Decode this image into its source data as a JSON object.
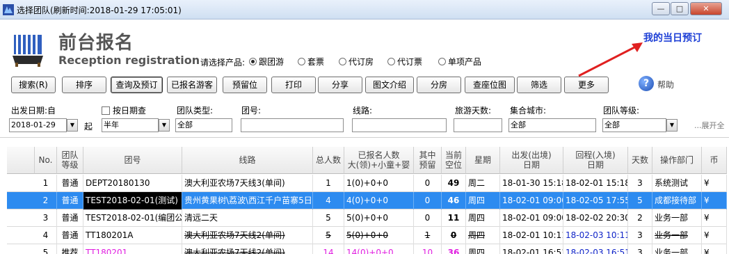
{
  "window": {
    "title": "选择团队(刷新时间:2018-01-29   17:05:01)",
    "minimize_glyph": "—",
    "maximize_glyph": "□",
    "close_glyph": "✕",
    "app_icon": "app-logo-icon"
  },
  "header": {
    "title_cn": "前台报名",
    "title_en": "Reception registration",
    "product_label": "请选择产品:",
    "products": [
      {
        "label": "跟团游",
        "selected": true
      },
      {
        "label": "套票",
        "selected": false
      },
      {
        "label": "代订房",
        "selected": false
      },
      {
        "label": "代订票",
        "selected": false
      },
      {
        "label": "单项产品",
        "selected": false
      }
    ],
    "my_booking": "我的当日预订"
  },
  "toolbar": {
    "buttons": [
      "搜索(R)",
      "排序",
      "查询及预订",
      "已报名游客",
      "预留位",
      "打印",
      "分享",
      "图文介绍",
      "分房",
      "查座位图",
      "筛选",
      "更多"
    ],
    "help_label": "帮助",
    "help_glyph": "?"
  },
  "filters": {
    "depart_date_label": "出发日期:自",
    "by_date_label": "按日期查",
    "group_type_label": "团队类型:",
    "group_no_label": "团号:",
    "route_label": "线路:",
    "days_label": "旅游天数:",
    "city_label": "集合城市:",
    "level_label": "团队等级:",
    "date_value": "2018-01-29",
    "from_label": "起",
    "range_value": "半年",
    "group_type_value": "全部",
    "group_no_value": "",
    "route_value": "",
    "days_value": "",
    "city_value": "全部",
    "level_value": "全部",
    "expand_label": "...展开全"
  },
  "grid": {
    "columns": [
      "No.",
      "团队\n等级",
      "团号",
      "线路",
      "总人数",
      "已报名人数\n大(领)+小童+婴",
      "其中\n预留",
      "当前\n空位",
      "星期",
      "出发(出境)\n日期",
      "回程(入境)\n日期",
      "天数",
      "操作部门",
      "币"
    ],
    "rows": [
      {
        "no": "1",
        "level": "普通",
        "code": "DEPT20180130",
        "route": "澳大利亚农场7天线3(单间)",
        "total": "1",
        "enrolled": "1(0)+0+0",
        "reserved": "0",
        "vacant": "49",
        "week": "周二",
        "depart": "18-01-30 15:18",
        "return": "18-02-01 15:18",
        "days": "3",
        "dept": "系统测试",
        "currency": "¥"
      },
      {
        "no": "2",
        "level": "普通",
        "code": "TEST2018-02-01(测试)",
        "route": "贵州黄果树\\荔波\\西江千户苗寨5日",
        "total": "4",
        "enrolled": "4(0)+0+0",
        "reserved": "0",
        "vacant": "46",
        "week": "周四",
        "depart": "18-02-01 09:00",
        "return": "18-02-05 17:55",
        "days": "5",
        "dept": "成都接待部",
        "currency": "¥"
      },
      {
        "no": "3",
        "level": "普通",
        "code": "TEST2018-02-01(编团公司)",
        "route": "清远二天",
        "total": "5",
        "enrolled": "5(0)+0+0",
        "reserved": "0",
        "vacant": "11",
        "week": "周四",
        "depart": "18-02-01 09:00",
        "return": "18-02-02 20:30",
        "days": "2",
        "dept": "业务一部",
        "currency": "¥"
      },
      {
        "no": "4",
        "level": "普通",
        "code": "TT180201A",
        "route": "澳大利亚农场7天线2(单间)",
        "total": "5",
        "enrolled": "5(0)+0+0",
        "reserved": "1",
        "vacant": "0",
        "week": "周四",
        "depart": "18-02-01 10:11",
        "return": "18-02-03 10:11",
        "days": "3",
        "dept": "业务一部",
        "currency": "¥"
      },
      {
        "no": "5",
        "level": "推荐",
        "code": "TT180201",
        "route": "澳大利亚农场7天线2(单间)",
        "total": "14",
        "enrolled": "14(0)+0+0",
        "reserved": "10",
        "vacant": "36",
        "week": "周四",
        "depart": "18-02-01 16:51",
        "return": "18-02-03 16:51",
        "days": "3",
        "dept": "业务一部",
        "currency": "¥"
      }
    ]
  },
  "colors": {
    "accent_blue": "#1d3fd6",
    "selection": "#2d8bf0",
    "highlight_pink": "#e01ee0",
    "arrow_red": "#e02020"
  }
}
